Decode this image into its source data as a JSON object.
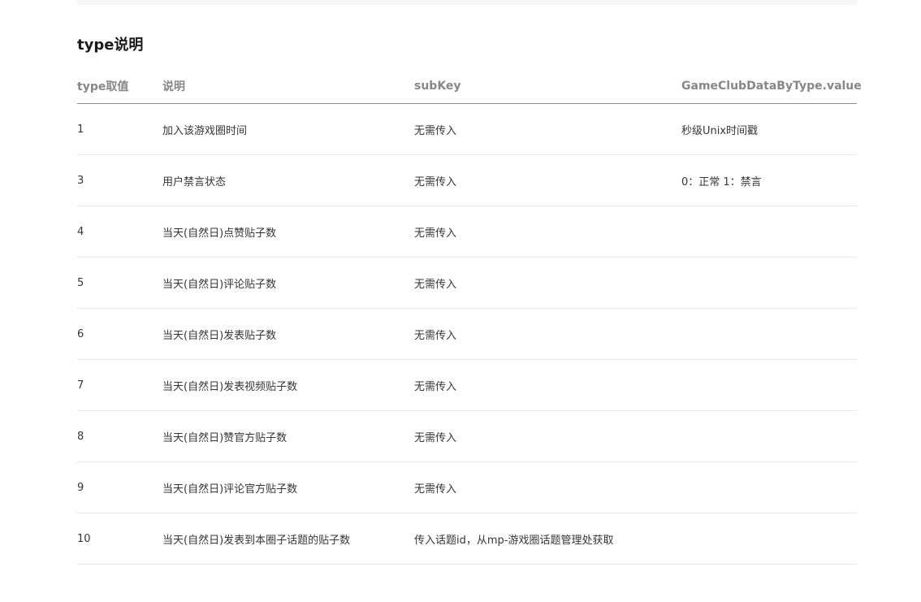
{
  "section": {
    "title": "type说明"
  },
  "table": {
    "headers": [
      "type取值",
      "说明",
      "subKey",
      "GameClubDataByType.value"
    ],
    "rows": [
      [
        "1",
        "加入该游戏圈时间",
        "无需传入",
        "秒级Unix时间戳"
      ],
      [
        "3",
        "用户禁言状态",
        "无需传入",
        "0：正常 1：禁言"
      ],
      [
        "4",
        "当天(自然日)点赞贴子数",
        "无需传入",
        ""
      ],
      [
        "5",
        "当天(自然日)评论贴子数",
        "无需传入",
        ""
      ],
      [
        "6",
        "当天(自然日)发表贴子数",
        "无需传入",
        ""
      ],
      [
        "7",
        "当天(自然日)发表视频贴子数",
        "无需传入",
        ""
      ],
      [
        "8",
        "当天(自然日)赞官方贴子数",
        "无需传入",
        ""
      ],
      [
        "9",
        "当天(自然日)评论官方贴子数",
        "无需传入",
        ""
      ],
      [
        "10",
        "当天(自然日)发表到本圈子话题的贴子数",
        "传入话题id，从mp-游戏圈话题管理处获取",
        ""
      ]
    ]
  }
}
